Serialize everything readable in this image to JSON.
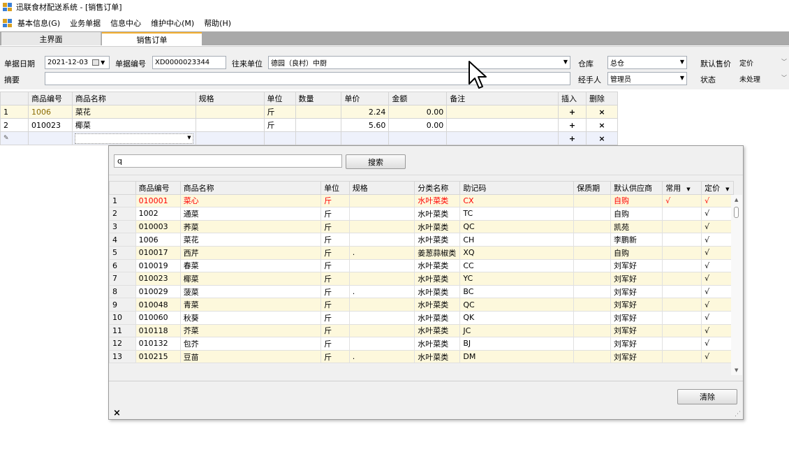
{
  "window": {
    "title": "迅联食材配送系统 - [销售订单]"
  },
  "menu": {
    "items": [
      "基本信息(G)",
      "业务单据",
      "信息中心",
      "维护中心(M)",
      "帮助(H)"
    ]
  },
  "tabs": [
    "主界面",
    "销售订单"
  ],
  "form": {
    "date_label": "单据日期",
    "date_value": "2021-12-03",
    "doc_no_label": "单据编号",
    "doc_no_value": "XD0000023344",
    "partner_label": "往来单位",
    "partner_value": "德园（良村）中厨",
    "warehouse_label": "仓库",
    "warehouse_value": "总仓",
    "default_price_label": "默认售价",
    "default_price_value": "定价",
    "summary_label": "摘要",
    "summary_value": "",
    "handler_label": "经手人",
    "handler_value": "管理员",
    "status_label": "状态",
    "status_value": "未处理"
  },
  "order_grid": {
    "headers": [
      "",
      "商品编号",
      "商品名称",
      "规格",
      "单位",
      "数量",
      "单价",
      "金额",
      "备注",
      "插入",
      "删除"
    ],
    "rows": [
      [
        "1",
        "1006",
        "菜花",
        "",
        "斤",
        "",
        "2.24",
        "0.00",
        "",
        "+",
        "×"
      ],
      [
        "2",
        "010023",
        "椰菜",
        "",
        "斤",
        "",
        "5.60",
        "0.00",
        "",
        "+",
        "×"
      ],
      [
        "",
        "",
        "",
        "",
        "",
        "",
        "",
        "",
        "",
        "+",
        "×"
      ]
    ]
  },
  "popup": {
    "search_value": "q",
    "search_button": "搜索",
    "clear_button": "清除",
    "close_label": "×",
    "headers": [
      "",
      "商品编号",
      "商品名称",
      "单位",
      "规格",
      "分类名称",
      "助记码",
      "保质期",
      "默认供应商",
      "常用",
      "定价"
    ],
    "rows": [
      [
        "1",
        "010001",
        "菜心",
        "斤",
        "",
        "水叶菜类",
        "CX",
        "",
        "自购",
        "√",
        "√"
      ],
      [
        "2",
        "1002",
        "通菜",
        "斤",
        "",
        "水叶菜类",
        "TC",
        "",
        "自购",
        "",
        "√"
      ],
      [
        "3",
        "010003",
        "荞菜",
        "斤",
        "",
        "水叶菜类",
        "QC",
        "",
        "凯苑",
        "",
        "√"
      ],
      [
        "4",
        "1006",
        "菜花",
        "斤",
        "",
        "水叶菜类",
        "CH",
        "",
        "李鹏新",
        "",
        "√"
      ],
      [
        "5",
        "010017",
        "西芹",
        "斤",
        ".",
        "姜葱蒜椒类",
        "XQ",
        "",
        "自购",
        "",
        "√"
      ],
      [
        "6",
        "010019",
        "春菜",
        "斤",
        "",
        "水叶菜类",
        "CC",
        "",
        "刘军好",
        "",
        "√"
      ],
      [
        "7",
        "010023",
        "椰菜",
        "斤",
        "",
        "水叶菜类",
        "YC",
        "",
        "刘军好",
        "",
        "√"
      ],
      [
        "8",
        "010029",
        "菠菜",
        "斤",
        ".",
        "水叶菜类",
        "BC",
        "",
        "刘军好",
        "",
        "√"
      ],
      [
        "9",
        "010048",
        "青菜",
        "斤",
        "",
        "水叶菜类",
        "QC",
        "",
        "刘军好",
        "",
        "√"
      ],
      [
        "10",
        "010060",
        "秋葵",
        "斤",
        "",
        "水叶菜类",
        "QK",
        "",
        "刘军好",
        "",
        "√"
      ],
      [
        "11",
        "010118",
        "芥菜",
        "斤",
        "",
        "水叶菜类",
        "JC",
        "",
        "刘军好",
        "",
        "√"
      ],
      [
        "12",
        "010132",
        "包芥",
        "斤",
        "",
        "水叶菜类",
        "BJ",
        "",
        "刘军好",
        "",
        "√"
      ],
      [
        "13",
        "010215",
        "豆苗",
        "斤",
        ".",
        "水叶菜类",
        "DM",
        "",
        "刘军好",
        "",
        "√"
      ]
    ]
  },
  "colors": {
    "accent_tab": "#f5b030",
    "selected_row_text": "#ff0000",
    "odd_row": "#fdf8dc"
  }
}
